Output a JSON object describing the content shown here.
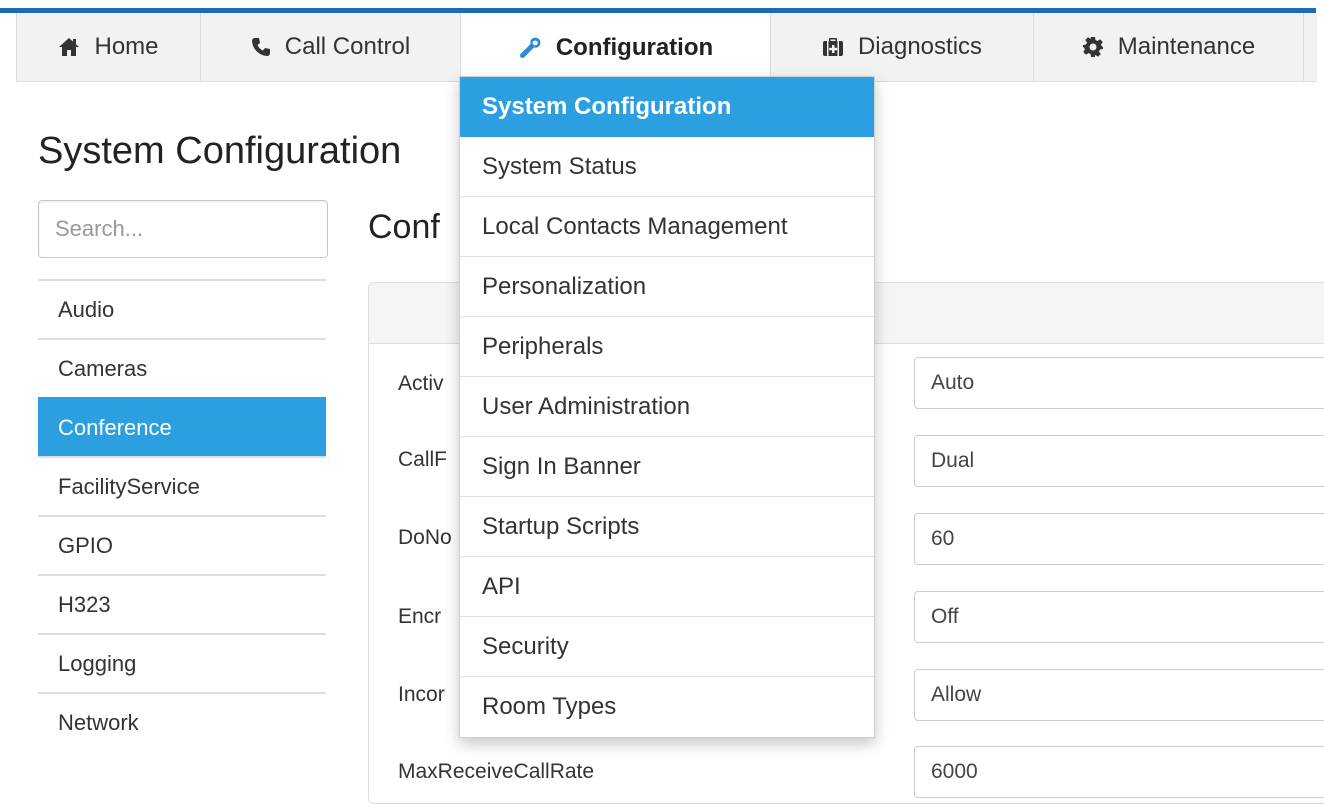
{
  "nav": {
    "tabs": [
      {
        "label": "Home",
        "icon": "home-icon"
      },
      {
        "label": "Call Control",
        "icon": "phone-icon"
      },
      {
        "label": "Configuration",
        "icon": "wrench-icon"
      },
      {
        "label": "Diagnostics",
        "icon": "medkit-icon"
      },
      {
        "label": "Maintenance",
        "icon": "gear-icon"
      }
    ],
    "active_tab": "Configuration",
    "accent_color": "#1e69b8"
  },
  "dropdown": {
    "items": [
      "System Configuration",
      "System Status",
      "Local Contacts Management",
      "Personalization",
      "Peripherals",
      "User Administration",
      "Sign In Banner",
      "Startup Scripts",
      "API",
      "Security",
      "Room Types"
    ],
    "active_item": "System Configuration",
    "highlight_color": "#2b9fe0"
  },
  "page": {
    "title": "System Configuration",
    "section_heading": "Conf"
  },
  "search": {
    "placeholder": "Search..."
  },
  "sidebar": {
    "items": [
      "Audio",
      "Cameras",
      "Conference",
      "FacilityService",
      "GPIO",
      "H323",
      "Logging",
      "Network"
    ],
    "active_item": "Conference"
  },
  "settings": {
    "rows": [
      {
        "label": "Activ",
        "value": "Auto"
      },
      {
        "label": "CallF",
        "value": "Dual"
      },
      {
        "label": "DoNo",
        "value": "60"
      },
      {
        "label": "Encr",
        "value": "Off"
      },
      {
        "label": "Incor",
        "value": "Allow"
      },
      {
        "label": "MaxReceiveCallRate",
        "value": "6000"
      }
    ]
  }
}
